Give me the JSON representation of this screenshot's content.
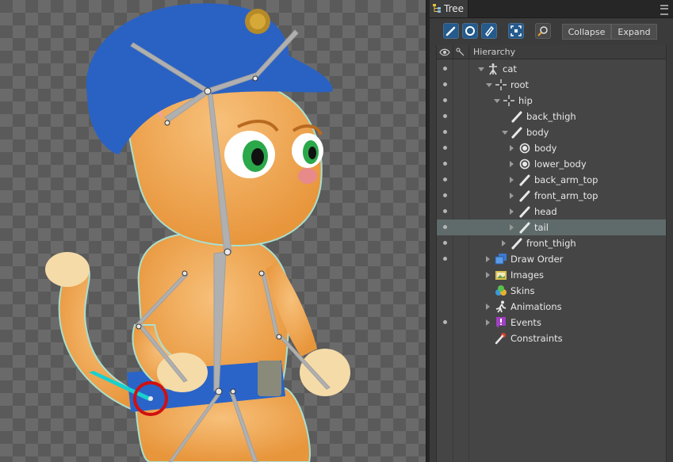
{
  "tab": {
    "title": "Tree"
  },
  "toolbar": {
    "collapse_label": "Collapse",
    "expand_label": "Expand"
  },
  "tree": {
    "header": "Hierarchy",
    "nodes": [
      {
        "label": "cat",
        "icon": "skeleton-icon",
        "expanded": true,
        "visible": true
      },
      {
        "label": "root",
        "icon": "root-bone-icon",
        "expanded": true,
        "visible": true
      },
      {
        "label": "hip",
        "icon": "root-bone-icon",
        "expanded": true,
        "visible": true
      },
      {
        "label": "back_thigh",
        "icon": "bone-icon",
        "expanded": false,
        "visible": true
      },
      {
        "label": "body",
        "icon": "bone-icon",
        "expanded": true,
        "visible": true
      },
      {
        "label": "body",
        "icon": "slot-icon",
        "expanded": false,
        "visible": true
      },
      {
        "label": "lower_body",
        "icon": "slot-icon",
        "expanded": false,
        "visible": true
      },
      {
        "label": "back_arm_top",
        "icon": "bone-icon",
        "expanded": false,
        "visible": true
      },
      {
        "label": "front_arm_top",
        "icon": "bone-icon",
        "expanded": false,
        "visible": true
      },
      {
        "label": "head",
        "icon": "bone-icon",
        "expanded": false,
        "visible": true
      },
      {
        "label": "tail",
        "icon": "bone-icon",
        "expanded": false,
        "visible": true,
        "selected": true
      },
      {
        "label": "front_thigh",
        "icon": "bone-icon",
        "expanded": false,
        "visible": true
      },
      {
        "label": "Draw Order",
        "icon": "draw-order-icon",
        "expanded": false,
        "visible": true
      },
      {
        "label": "Images",
        "icon": "images-folder-icon",
        "expanded": false,
        "visible": false
      },
      {
        "label": "Skins",
        "icon": "skins-icon",
        "expanded": false,
        "visible": false
      },
      {
        "label": "Animations",
        "icon": "animations-icon",
        "expanded": false,
        "visible": false
      },
      {
        "label": "Events",
        "icon": "events-icon",
        "expanded": false,
        "visible": true
      },
      {
        "label": "Constraints",
        "icon": "constraints-icon",
        "expanded": false,
        "visible": false
      }
    ]
  },
  "colors": {
    "accent_blue": "#245a8c",
    "selected_row": "#5f6b6a",
    "selection_ring": "#d01010",
    "panel_bg": "#3b3b3b"
  }
}
